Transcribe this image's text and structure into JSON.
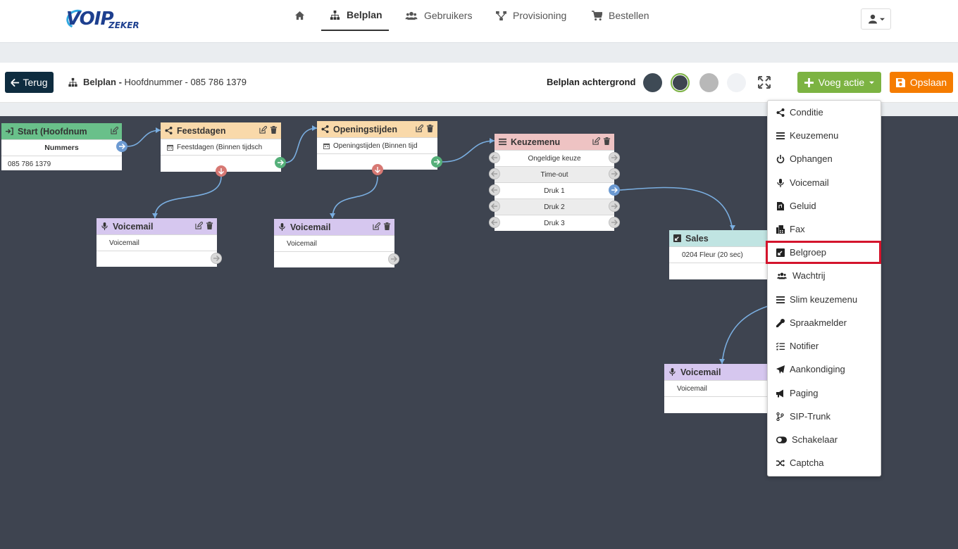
{
  "nav": {
    "logo_text": "VOIP",
    "logo_sub": "ZEKER",
    "items": [
      {
        "label": "",
        "icon": "home-icon"
      },
      {
        "label": "Belplan",
        "icon": "sitemap-icon",
        "active": true
      },
      {
        "label": "Gebruikers",
        "icon": "users-icon"
      },
      {
        "label": "Provisioning",
        "icon": "provisioning-icon"
      },
      {
        "label": "Bestellen",
        "icon": "cart-icon"
      }
    ]
  },
  "toolbar": {
    "back_label": "Terug",
    "crumb_title": "Belplan -",
    "crumb_subtitle": "Hoofdnummer - 085 786 1379",
    "background_label": "Belplan achtergrond",
    "swatches": [
      "#3e4a55",
      "#3e4450",
      "#b8b8b8",
      "#f0f2f5"
    ],
    "add_action_label": "Voeg actie",
    "save_label": "Opslaan"
  },
  "nodes": {
    "start": {
      "title": "Start (Hoofdnum",
      "rows": [
        "Nummers",
        "085 786 1379"
      ],
      "color": "#69c08a"
    },
    "feestdagen": {
      "title": "Feestdagen",
      "rows": [
        "Feestdagen (Binnen tijdsch"
      ],
      "color": "#f9d9aa"
    },
    "openingstijden": {
      "title": "Openingstijden",
      "rows": [
        "Openingstijden (Binnen tijd"
      ],
      "color": "#f9d9aa"
    },
    "keuzemenu": {
      "title": "Keuzemenu",
      "rows": [
        "Ongeldige keuze",
        "Time-out",
        "Druk 1",
        "Druk 2",
        "Druk 3"
      ],
      "color": "#eec3c3"
    },
    "voicemail1": {
      "title": "Voicemail",
      "rows": [
        "Voicemail"
      ],
      "color": "#d6c7ef"
    },
    "voicemail2": {
      "title": "Voicemail",
      "rows": [
        "Voicemail"
      ],
      "color": "#d6c7ef"
    },
    "sales": {
      "title": "Sales",
      "rows": [
        "0204 Fleur (20 sec)"
      ],
      "color": "#c0e4e2"
    },
    "voicemail3": {
      "title": "Voicemail",
      "rows": [
        "Voicemail"
      ],
      "color": "#d6c7ef"
    }
  },
  "dropdown": {
    "items": [
      {
        "label": "Conditie",
        "icon": "share-icon"
      },
      {
        "label": "Keuzemenu",
        "icon": "list-icon"
      },
      {
        "label": "Ophangen",
        "icon": "power-icon"
      },
      {
        "label": "Voicemail",
        "icon": "microphone-icon"
      },
      {
        "label": "Geluid",
        "icon": "audio-file-icon"
      },
      {
        "label": "Fax",
        "icon": "fax-icon"
      },
      {
        "label": "Belgroep",
        "icon": "belgroep-icon",
        "highlighted": true
      },
      {
        "label": "Wachtrij",
        "icon": "users-icon"
      },
      {
        "label": "Slim keuzemenu",
        "icon": "list-icon"
      },
      {
        "label": "Spraakmelder",
        "icon": "spraakmelder-icon"
      },
      {
        "label": "Notifier",
        "icon": "tasks-icon"
      },
      {
        "label": "Aankondiging",
        "icon": "paper-plane-icon"
      },
      {
        "label": "Paging",
        "icon": "bullhorn-icon"
      },
      {
        "label": "SIP-Trunk",
        "icon": "code-branch-icon"
      },
      {
        "label": "Schakelaar",
        "icon": "toggle-icon"
      },
      {
        "label": "Captcha",
        "icon": "random-icon"
      }
    ]
  }
}
